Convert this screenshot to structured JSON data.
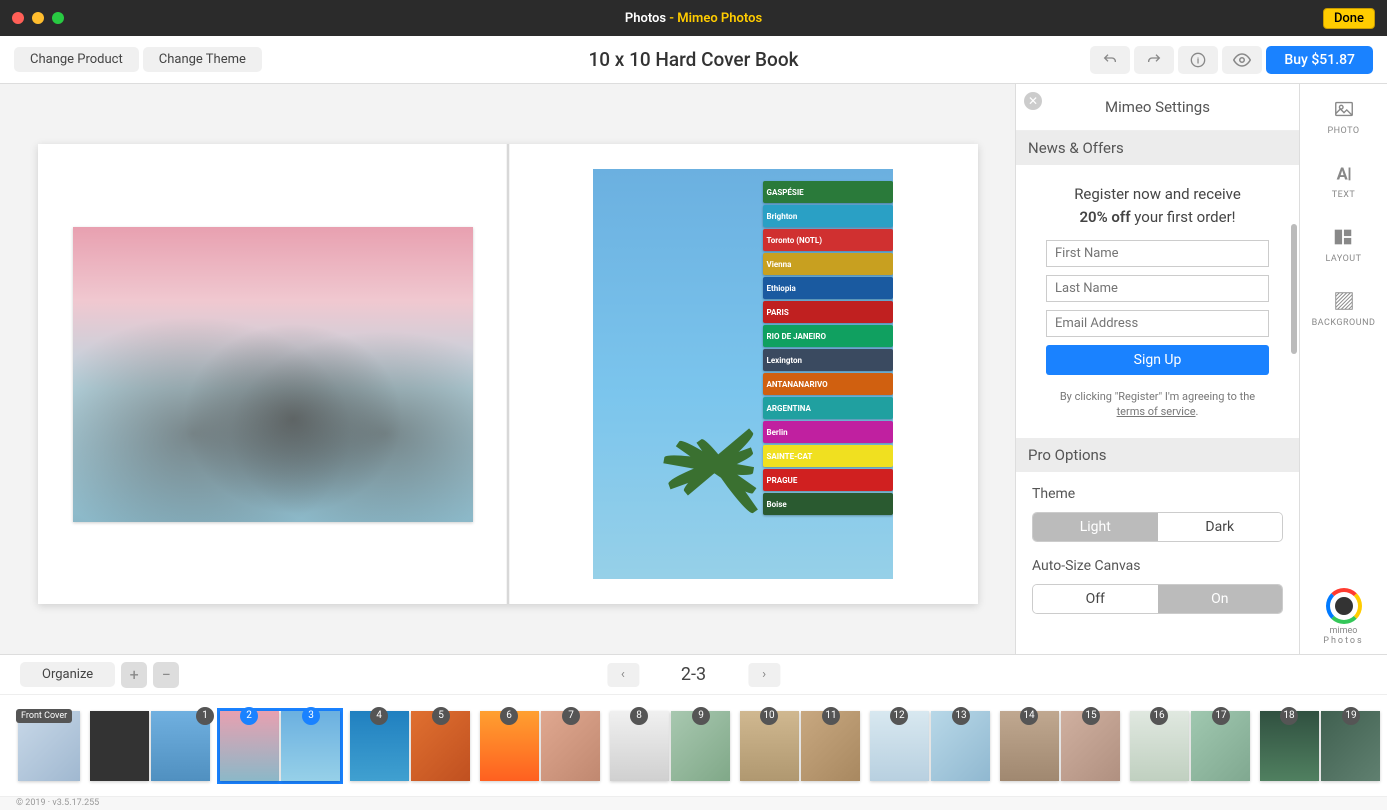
{
  "titlebar": {
    "app": "Photos",
    "sep": " - ",
    "ext": "Mimeo Photos",
    "done": "Done"
  },
  "toolbar": {
    "change_product": "Change Product",
    "change_theme": "Change Theme",
    "title": "10 x 10 Hard Cover Book",
    "buy": "Buy $51.87"
  },
  "settings": {
    "title": "Mimeo Settings",
    "news_h": "News & Offers",
    "reg_line1": "Register now and receive",
    "reg_bold": "20% off",
    "reg_line2": " your first order!",
    "first_ph": "First Name",
    "last_ph": "Last Name",
    "email_ph": "Email Address",
    "signup": "Sign Up",
    "fine1": "By clicking \"Register\" I'm agreeing to the ",
    "fine_link": "terms of service",
    "fine2": ".",
    "pro_h": "Pro Options",
    "theme_label": "Theme",
    "theme_light": "Light",
    "theme_dark": "Dark",
    "auto_label": "Auto-Size Canvas",
    "auto_off": "Off",
    "auto_on": "On"
  },
  "tabs": {
    "photo": "PHOTO",
    "text": "TEXT",
    "layout": "LAYOUT",
    "background": "BACKGROUND",
    "brand": "mimeo",
    "brand2": "Photos"
  },
  "bottom": {
    "organize": "Organize",
    "pages": "2-3"
  },
  "thumbs": {
    "front_cover": "Front Cover",
    "pages": [
      "1",
      "2",
      "3",
      "4",
      "5",
      "6",
      "7",
      "8",
      "9",
      "10",
      "11",
      "12",
      "13",
      "14",
      "15",
      "16",
      "17",
      "18",
      "19"
    ]
  },
  "footer": "© 2019 · v3.5.17.255",
  "signs": [
    {
      "t": "GASPÉSIE",
      "c": "#2a7a3a"
    },
    {
      "t": "Brighton",
      "c": "#2aa0c5"
    },
    {
      "t": "Toronto (NOTL)",
      "c": "#d03030"
    },
    {
      "t": "Vienna",
      "c": "#c8a020"
    },
    {
      "t": "Ethiopia",
      "c": "#1a5aa0"
    },
    {
      "t": "PARIS",
      "c": "#c02020"
    },
    {
      "t": "RIO DE JANEIRO",
      "c": "#10a060"
    },
    {
      "t": "Lexington",
      "c": "#3a4a60"
    },
    {
      "t": "ANTANANARIVO",
      "c": "#d06010"
    },
    {
      "t": "ARGENTINA",
      "c": "#20a0a0"
    },
    {
      "t": "Berlin",
      "c": "#c020a0"
    },
    {
      "t": "SAINTE-CAT",
      "c": "#f0e020"
    },
    {
      "t": "PRAGUE",
      "c": "#d02020"
    },
    {
      "t": "Boise",
      "c": "#2a5a30"
    }
  ]
}
